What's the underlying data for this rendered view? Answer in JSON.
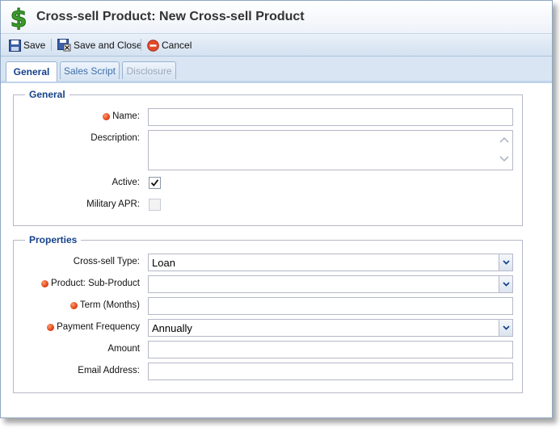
{
  "window": {
    "title": "Cross-sell Product: New Cross-sell Product"
  },
  "toolbar": {
    "save": "Save",
    "save_close": "Save and Close",
    "cancel": "Cancel"
  },
  "tabs": [
    {
      "label": "General",
      "active": true
    },
    {
      "label": "Sales Script",
      "active": false
    },
    {
      "label": "Disclosure",
      "active": false,
      "disabled": true
    }
  ],
  "general": {
    "legend": "General",
    "name_label": "Name:",
    "name_value": "",
    "description_label": "Description:",
    "description_value": "",
    "active_label": "Active:",
    "active_checked": true,
    "military_label": "Military APR:",
    "military_checked": false
  },
  "properties": {
    "legend": "Properties",
    "type_label": "Cross-sell Type:",
    "type_value": "Loan",
    "product_label": "Product: Sub-Product",
    "product_value": "",
    "term_label": "Term (Months)",
    "term_value": "",
    "frequency_label": "Payment Frequency",
    "frequency_value": "Annually",
    "amount_label": "Amount",
    "amount_value": "",
    "email_label": "Email Address:",
    "email_value": ""
  },
  "colors": {
    "accent": "#15428b",
    "required": "#e0451a",
    "toolbar": "#d5e2f1"
  }
}
